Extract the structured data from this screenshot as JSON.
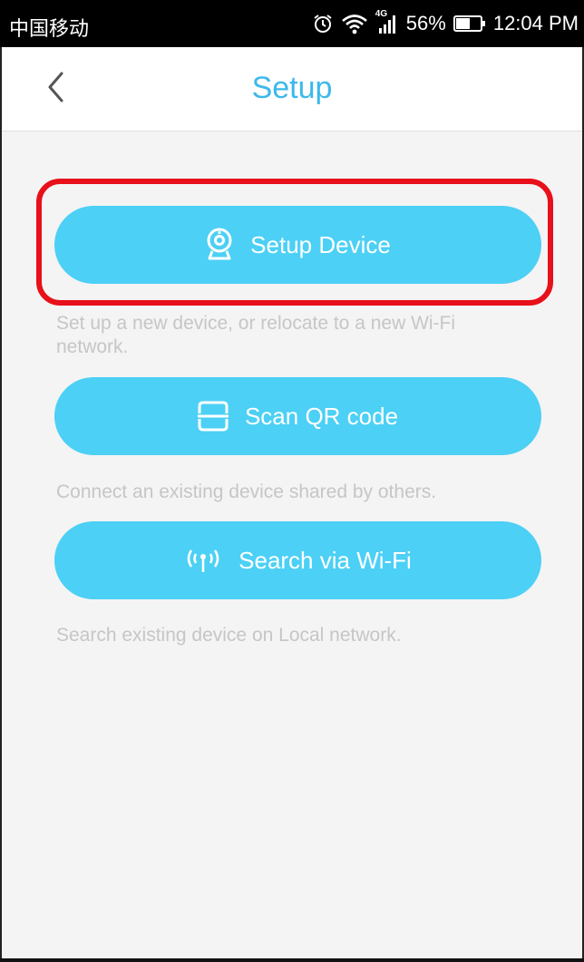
{
  "status_bar": {
    "carrier": "中国移动",
    "network": "4G",
    "battery": "56%",
    "time": "12:04 PM",
    "icons": [
      "alarm-icon",
      "wifi-icon",
      "signal-icon",
      "battery-icon"
    ]
  },
  "header": {
    "title": "Setup",
    "back_icon": "chevron-left-icon"
  },
  "actions": [
    {
      "label": "Setup Device",
      "icon": "webcam-icon",
      "description": "Set up a new device, or relocate to a new Wi-Fi network.",
      "highlighted": true
    },
    {
      "label": "Scan QR code",
      "icon": "qr-scan-icon",
      "description": "Connect an existing device shared by others."
    },
    {
      "label": "Search via Wi-Fi",
      "icon": "wireless-antenna-icon",
      "description": "Search existing device on Local network."
    }
  ],
  "colors": {
    "accent": "#3cb9ea",
    "button": "#4cd0f5",
    "highlight": "#e8101a",
    "description_text": "#c6c6c6",
    "background": "#f4f4f4"
  }
}
